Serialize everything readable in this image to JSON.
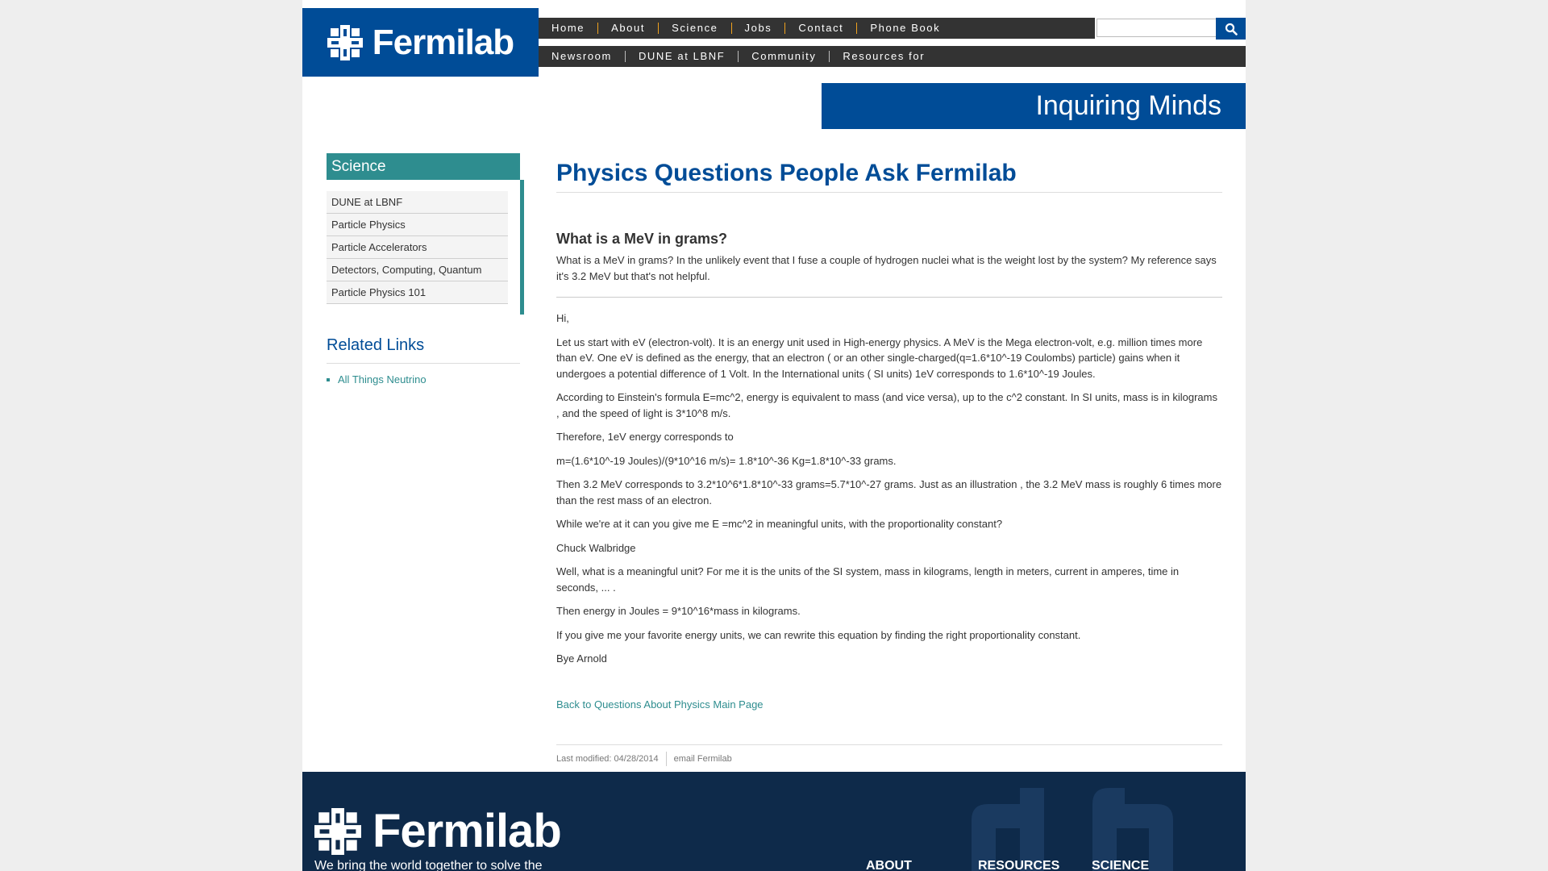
{
  "logo": {
    "text": "Fermilab"
  },
  "nav_primary": [
    "Home",
    "About",
    "Science",
    "Jobs",
    "Contact",
    "Phone Book"
  ],
  "nav_secondary": [
    "Newsroom",
    "DUNE at LBNF",
    "Community",
    "Resources for"
  ],
  "search": {
    "placeholder": "",
    "icon": "search-icon"
  },
  "banner": {
    "title": "Inquiring Minds"
  },
  "sidebar": {
    "section_title": "Science",
    "items": [
      {
        "label": "DUNE at LBNF"
      },
      {
        "label": "Particle Physics"
      },
      {
        "label": "Particle Accelerators"
      },
      {
        "label": "Detectors, Computing, Quantum"
      },
      {
        "label": "Particle Physics 101"
      }
    ],
    "related_title": "Related Links",
    "related_links": [
      {
        "label": "All Things Neutrino"
      }
    ]
  },
  "main": {
    "page_title": "Physics Questions People Ask Fermilab",
    "question_title": "What is a MeV in grams?",
    "question_body": "What is a MeV in grams? In the unlikely event that I fuse a couple of hydrogen nuclei what is the weight lost by the system? My reference says it's 3.2 MeV but that's not helpful.",
    "answer": [
      "Hi,",
      "Let us start with eV (electron-volt). It is an energy unit used in High-energy physics. A MeV is the Mega electron-volt, e.g. million times more than eV. One eV is defined as the energy, that an electron ( or an other single-charged(q=1.6*10^-19 Coulombs) particle) gains when it undergoes a potential difference of 1 Volt. In the International units ( SI units) 1eV corresponds to 1.6*10^-19 Joules.",
      "According to Einstein's formula E=mc^2, energy is equivalent to mass (and vice versa), up to the c^2 constant. In SI units, mass is in kilograms , and the speed of light is 3*10^8 m/s.",
      "Therefore, 1eV energy corresponds to",
      "m=(1.6*10^-19 Joules)/(9*10^16 m/s)= 1.8*10^-36 Kg=1.8*10^-33 grams.",
      "Then 3.2 MeV corresponds to 3.2*10^6*1.8*10^-33 grams=5.7*10^-27 grams. Just as an illustration , the 3.2 MeV mass is roughly 6 times more than the rest mass of an electron.",
      "While we're at it can you give me E =mc^2 in meaningful units, with the proportionality constant?",
      "Chuck Walbridge",
      "Well, what is a meaningful unit? For me it is the units of the SI system, mass in kilograms, length in meters, current in amperes, time in seconds, ... .",
      "Then energy in Joules = 9*10^16*mass in kilograms.",
      "If you give me your favorite energy units, we can rewrite this equation by finding the right proportionality constant.",
      "Bye Arnold"
    ],
    "back_link": "Back to Questions About Physics Main Page",
    "last_modified": "Last modified: 04/28/2014",
    "email_link": "email Fermilab"
  },
  "footer": {
    "logo_text": "Fermilab",
    "tagline": "We bring the world together to solve the",
    "columns": [
      "ABOUT",
      "RESOURCES",
      "SCIENCE"
    ]
  },
  "colors": {
    "brand_blue": "#004c97",
    "teal": "#2e8d8f",
    "nav_dark": "#333333",
    "nav_divider": "#f0a21e",
    "footer_navy": "#0e2a4a"
  }
}
